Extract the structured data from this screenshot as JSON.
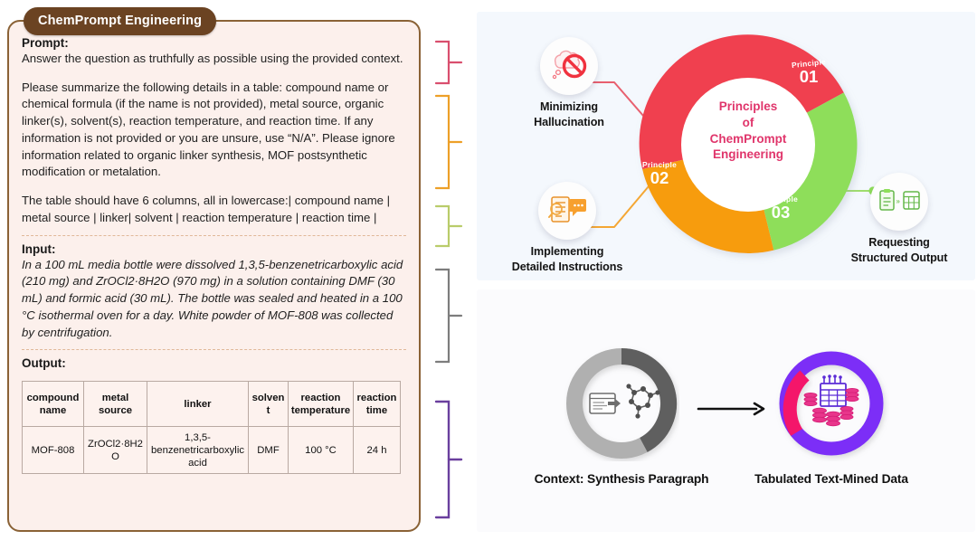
{
  "left_panel": {
    "tab_title": "ChemPrompt Engineering",
    "prompt_label": "Prompt:",
    "prompt_line1": "Answer the question as truthfully as possible using the provided context.",
    "prompt_para2": "Please summarize the following details in a table: compound name or chemical formula (if the name is not provided), metal source, organic linker(s), solvent(s), reaction temperature, and reaction time. If any information is not provided or you are unsure, use “N/A”. Please ignore information related to organic linker synthesis, MOF postsynthetic modification or metalation.",
    "prompt_para3": "The table should have 6 columns, all in lowercase:| compound name | metal source | linker| solvent | reaction temperature | reaction time |",
    "input_label": "Input:",
    "input_text": "In a 100 mL media bottle were dissolved 1,3,5-benzenetricarboxylic acid (210 mg) and ZrOCl2·8H2O (970 mg) in a solution containing DMF (30 mL) and formic acid (30 mL). The bottle was sealed and heated in a 100 °C isothermal oven for a day. White powder of MOF-808 was collected by centrifugation.",
    "output_label": "Output:",
    "table": {
      "headers": [
        "compound name",
        "metal source",
        "linker",
        "solvent",
        "reaction temperature",
        "reaction time"
      ],
      "rows": [
        [
          "MOF-808",
          "ZrOCl2·8H2O",
          "1,3,5-benzenetricarboxylic acid",
          "DMF",
          "100 °C",
          "24 h"
        ]
      ]
    }
  },
  "brackets": [
    {
      "name": "bracket-prompt-line1",
      "color": "#d94f6e"
    },
    {
      "name": "bracket-prompt-summary",
      "color": "#eda028"
    },
    {
      "name": "bracket-prompt-columns",
      "color": "#b9cc6a"
    },
    {
      "name": "bracket-input",
      "color": "#7d7d7d"
    },
    {
      "name": "bracket-output",
      "color": "#6a3f9e"
    }
  ],
  "principles_panel": {
    "center_lines": [
      "Principles",
      "of",
      "ChemPrompt",
      "Engineering"
    ],
    "center_color": "#e0356b",
    "segments": [
      {
        "principle_label": "Principle",
        "number": "01",
        "color": "#f0414f",
        "node": "minimizing-hallucination"
      },
      {
        "principle_label": "Principle",
        "number": "02",
        "color": "#f79c0e",
        "node": "implementing-detailed-instructions"
      },
      {
        "principle_label": "Principle",
        "number": "03",
        "color": "#8ede5a",
        "node": "requesting-structured-output"
      }
    ],
    "nodes": [
      {
        "id": "minimizing-hallucination",
        "line1": "Minimizing",
        "line2": "Hallucination",
        "accent": "#f0414f",
        "icon": "no-entry-thought-bubble-icon"
      },
      {
        "id": "implementing-detailed-instructions",
        "line1": "Implementing",
        "line2": "Detailed Instructions",
        "accent": "#f79c0e",
        "icon": "document-chat-magnifier-icon"
      },
      {
        "id": "requesting-structured-output",
        "line1": "Requesting",
        "line2": "Structured Output",
        "accent": "#7ed957",
        "icon": "clipboard-to-table-icon"
      }
    ]
  },
  "flow_panel": {
    "items": [
      {
        "id": "context-synthesis-paragraph",
        "caption": "Context: Synthesis Paragraph",
        "ring_colors": [
          "#b0b0b0",
          "#5f5f5f"
        ],
        "icon": "document-to-molecule-icon"
      },
      {
        "id": "tabulated-text-mined-data",
        "caption": "Tabulated Text-Mined Data",
        "ring_colors": [
          "#7b2ff7",
          "#f4136b"
        ],
        "icon": "database-table-icon"
      }
    ],
    "arrow": "right-arrow-icon"
  }
}
